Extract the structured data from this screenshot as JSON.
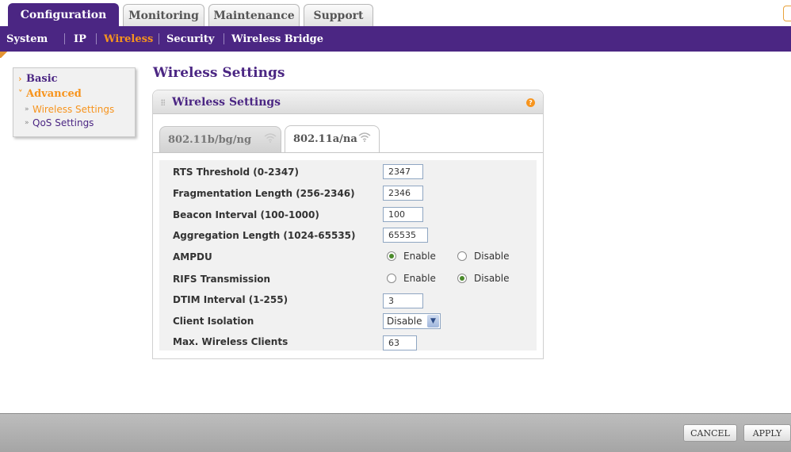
{
  "top_tabs": [
    {
      "label": "Configuration",
      "active": true
    },
    {
      "label": "Monitoring",
      "active": false
    },
    {
      "label": "Maintenance",
      "active": false
    },
    {
      "label": "Support",
      "active": false
    }
  ],
  "subnav": [
    {
      "label": "System",
      "active": false
    },
    {
      "label": "IP",
      "active": false
    },
    {
      "label": "Wireless",
      "active": true
    },
    {
      "label": "Security",
      "active": false
    },
    {
      "label": "Wireless Bridge",
      "active": false
    }
  ],
  "left_menu": {
    "basic": "Basic",
    "advanced": "Advanced",
    "wireless_settings": "Wireless Settings",
    "qos_settings": "QoS Settings"
  },
  "page_title": "Wireless Settings",
  "panel": {
    "title": "Wireless Settings",
    "help_icon": "?",
    "tabs": [
      {
        "label": "802.11b/bg/ng",
        "active": false,
        "icon": "wifi-icon"
      },
      {
        "label": "802.11a/na",
        "active": true,
        "icon": "wifi-icon"
      }
    ]
  },
  "form": {
    "rts_threshold": {
      "label": "RTS Threshold (0-2347)",
      "value": "2347"
    },
    "fragmentation_length": {
      "label": "Fragmentation Length (256-2346)",
      "value": "2346"
    },
    "beacon_interval": {
      "label": "Beacon Interval (100-1000)",
      "value": "100"
    },
    "aggregation_length": {
      "label": "Aggregation Length (1024-65535)",
      "value": "65535"
    },
    "ampdu": {
      "label": "AMPDU",
      "enable": "Enable",
      "disable": "Disable",
      "selected": "Enable"
    },
    "rifs": {
      "label": "RIFS Transmission",
      "enable": "Enable",
      "disable": "Disable",
      "selected": "Disable"
    },
    "dtim_interval": {
      "label": "DTIM Interval (1-255)",
      "value": "3"
    },
    "client_isolation": {
      "label": "Client Isolation",
      "value": "Disable"
    },
    "max_clients": {
      "label": "Max. Wireless Clients",
      "value": "63"
    }
  },
  "footer": {
    "cancel": "CANCEL",
    "apply": "APPLY"
  },
  "colors": {
    "brand_purple": "#4b2683",
    "accent_orange": "#f7941d"
  }
}
